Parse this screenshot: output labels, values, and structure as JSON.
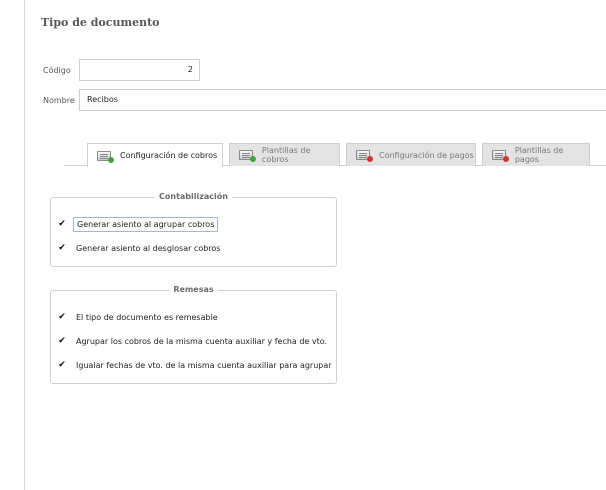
{
  "page": {
    "title": "Tipo de documento"
  },
  "form": {
    "codigo": {
      "label": "Código",
      "value": "2"
    },
    "nombre": {
      "label": "Nombre",
      "value": "Recibos"
    }
  },
  "tabs": [
    {
      "label": "Configuración de cobros",
      "icon": "document-add-icon",
      "active": true
    },
    {
      "label": "Plantillas de cobros",
      "icon": "document-add-icon",
      "active": false
    },
    {
      "label": "Configuración de pagos",
      "icon": "document-remove-icon",
      "active": false
    },
    {
      "label": "Plantillas de pagos",
      "icon": "document-remove-icon",
      "active": false
    }
  ],
  "contabilizacion": {
    "legend": "Contabilización",
    "options": [
      {
        "label": "Generar asiento al agrupar cobros",
        "checked": true,
        "mark": "✔"
      },
      {
        "label": "Generar asiento al desglosar cobros",
        "checked": true,
        "mark": "✔"
      }
    ]
  },
  "remesas": {
    "legend": "Remesas",
    "options": [
      {
        "label": "El tipo de documento es remesable",
        "checked": true,
        "mark": "✔"
      },
      {
        "label": "Agrupar los cobros de la misma cuenta auxiliar y fecha de vto.",
        "checked": true,
        "mark": "✔"
      },
      {
        "label": "Igualar fechas de vto. de la misma cuenta auxiliar para agrupar",
        "checked": true,
        "mark": "✔"
      }
    ]
  },
  "colors": {
    "tab_inactive_bg": "#e3e3e3",
    "border": "#cfcfcf",
    "focus_border": "#9fb7d8"
  }
}
